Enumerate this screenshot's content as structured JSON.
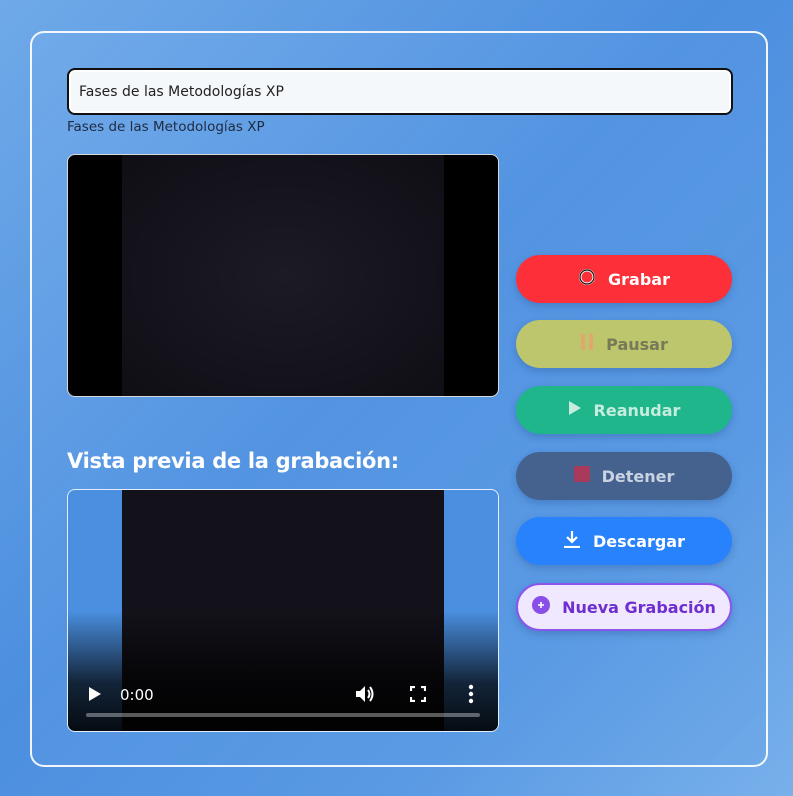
{
  "title_input": {
    "value": "Fases de las Metodologías XP"
  },
  "title_label": "Fases de las Metodologías XP",
  "preview": {
    "heading": "Vista previa de la grabación:",
    "time": "0:00"
  },
  "buttons": {
    "record": "Grabar",
    "pause": "Pausar",
    "resume": "Reanudar",
    "stop": "Detener",
    "download": "Descargar",
    "new_recording": "Nueva Grabación"
  },
  "colors": {
    "record": "#fd2f38",
    "pause": "#bdc66d",
    "resume": "#1fb68c",
    "stop": "#45628f",
    "download": "#2882fb",
    "new_recording_border": "#8a55ea"
  },
  "icons": {
    "record": "record-circle-icon",
    "pause": "pause-icon",
    "resume": "play-icon",
    "stop": "stop-square-icon",
    "download": "download-icon",
    "new_recording": "plus-circle-icon"
  }
}
